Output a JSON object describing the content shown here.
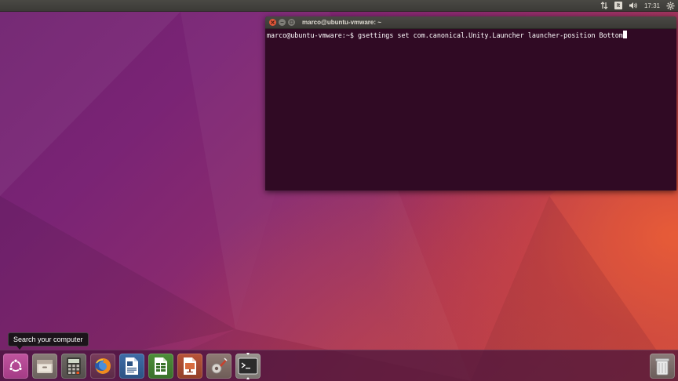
{
  "top_panel": {
    "clock": "17:31",
    "keyboard_layout": "It",
    "icons": [
      "network-updown-icon",
      "keyboard-layout-icon",
      "volume-icon",
      "system-gear-icon"
    ]
  },
  "terminal": {
    "title": "marco@ubuntu-vmware: ~",
    "prompt": "marco@ubuntu-vmware:~$ ",
    "command": "gsettings set com.canonical.Unity.Launcher launcher-position Bottom"
  },
  "tooltip": {
    "text": "Search your computer"
  },
  "launcher": {
    "items": [
      {
        "name": "ubuntu-dash-icon",
        "running": false
      },
      {
        "name": "files-manager-icon",
        "running": false
      },
      {
        "name": "calculator-icon",
        "running": false
      },
      {
        "name": "firefox-icon",
        "running": false
      },
      {
        "name": "libreoffice-writer-icon",
        "running": false
      },
      {
        "name": "libreoffice-calc-icon",
        "running": false
      },
      {
        "name": "libreoffice-impress-icon",
        "running": false
      },
      {
        "name": "system-settings-icon",
        "running": false
      },
      {
        "name": "terminal-icon",
        "running": true
      },
      {
        "name": "trash-icon",
        "running": false
      }
    ]
  },
  "colors": {
    "terminal_bg": "#300a24",
    "panel_bg": "#3c3b37",
    "close_button": "#e2573a",
    "ubuntu_orange": "#e95420"
  }
}
